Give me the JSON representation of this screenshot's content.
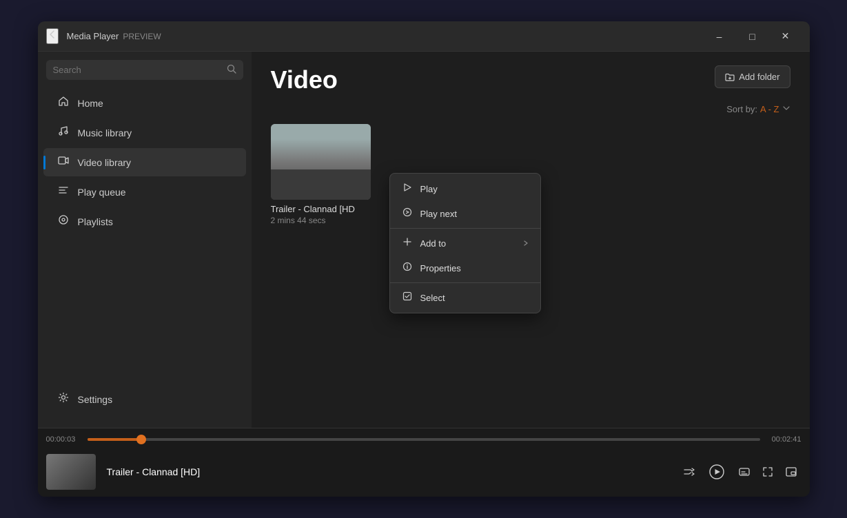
{
  "window": {
    "title": "Media Player",
    "subtitle": "PREVIEW"
  },
  "titlebar": {
    "back_label": "←",
    "minimize_label": "–",
    "maximize_label": "□",
    "close_label": "✕"
  },
  "sidebar": {
    "search_placeholder": "Search",
    "nav_items": [
      {
        "id": "home",
        "label": "Home",
        "icon": "⌂"
      },
      {
        "id": "music-library",
        "label": "Music library",
        "icon": "♪"
      },
      {
        "id": "video-library",
        "label": "Video library",
        "icon": "▣",
        "active": true
      },
      {
        "id": "play-queue",
        "label": "Play queue",
        "icon": "≡"
      },
      {
        "id": "playlists",
        "label": "Playlists",
        "icon": "◎"
      }
    ],
    "settings_label": "Settings",
    "settings_icon": "⚙"
  },
  "content": {
    "title": "Video",
    "add_folder_label": "Add folder",
    "sort_label": "Sort by:",
    "sort_value": "A - Z",
    "videos": [
      {
        "title": "Trailer - Clannad [HD",
        "title_full": "Trailer - Clannad [HD]",
        "duration": "2 mins 44 secs"
      }
    ]
  },
  "context_menu": {
    "items": [
      {
        "id": "play",
        "label": "Play",
        "icon": "▷"
      },
      {
        "id": "play-next",
        "label": "Play next",
        "icon": "↗"
      },
      {
        "id": "add-to",
        "label": "Add to",
        "icon": "+",
        "has_arrow": true
      },
      {
        "id": "properties",
        "label": "Properties",
        "icon": "ℹ"
      },
      {
        "id": "select",
        "label": "Select",
        "icon": "◻"
      }
    ]
  },
  "player": {
    "title": "Trailer - Clannad [HD]",
    "current_time": "00:00:03",
    "total_time": "00:02:41",
    "progress_percent": 2
  }
}
